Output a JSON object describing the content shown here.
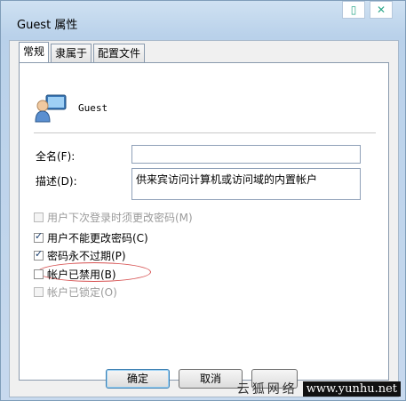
{
  "window": {
    "title": "Guest 属性"
  },
  "tabs": [
    {
      "label": "常规",
      "active": true
    },
    {
      "label": "隶属于",
      "active": false
    },
    {
      "label": "配置文件",
      "active": false
    }
  ],
  "user": {
    "name": "Guest",
    "icon": "user-computer-icon"
  },
  "fields": {
    "fullname_label": "全名(F):",
    "fullname_value": "",
    "description_label": "描述(D):",
    "description_value": "供来宾访问计算机或访问域的内置帐户"
  },
  "checkboxes": [
    {
      "label": "用户下次登录时须更改密码(M)",
      "checked": false,
      "enabled": false
    },
    {
      "label": "用户不能更改密码(C)",
      "checked": true,
      "enabled": true
    },
    {
      "label": "密码永不过期(P)",
      "checked": true,
      "enabled": true
    },
    {
      "label": "帐户已禁用(B)",
      "checked": false,
      "enabled": true
    },
    {
      "label": "帐户已锁定(O)",
      "checked": false,
      "enabled": false
    }
  ],
  "buttons": {
    "ok": "确定",
    "cancel": "取消"
  },
  "watermark": {
    "name": "云狐网络",
    "url": "www.yunhu.net"
  }
}
